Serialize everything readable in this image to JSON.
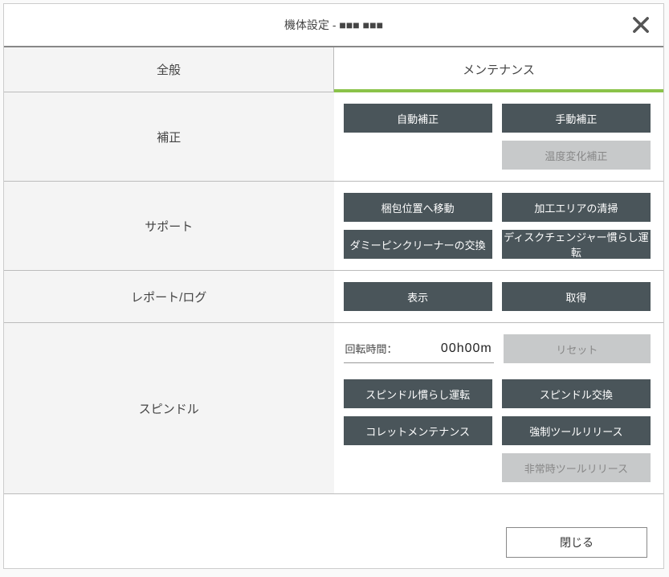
{
  "header": {
    "title": "機体設定 - ■■■ ■■■"
  },
  "tabs": {
    "general": "全般",
    "maintenance": "メンテナンス"
  },
  "sections": {
    "correction": {
      "label": "補正",
      "auto": "自動補正",
      "manual": "手動補正",
      "temp": "温度変化補正"
    },
    "support": {
      "label": "サポート",
      "moveToPack": "梱包位置へ移動",
      "cleanArea": "加工エリアの清掃",
      "dummyPin": "ダミーピンクリーナーの交換",
      "discChanger": "ディスクチェンジャー慣らし運転"
    },
    "report": {
      "label": "レポート/ログ",
      "show": "表示",
      "get": "取得"
    },
    "spindle": {
      "label": "スピンドル",
      "timeLabel": "回転時間：",
      "timeValue": "00h00m",
      "reset": "リセット",
      "runin": "スピンドル慣らし運転",
      "exchange": "スピンドル交換",
      "collet": "コレットメンテナンス",
      "forceRelease": "強制ツールリリース",
      "emergencyRelease": "非常時ツールリリース"
    }
  },
  "footer": {
    "close": "閉じる"
  }
}
